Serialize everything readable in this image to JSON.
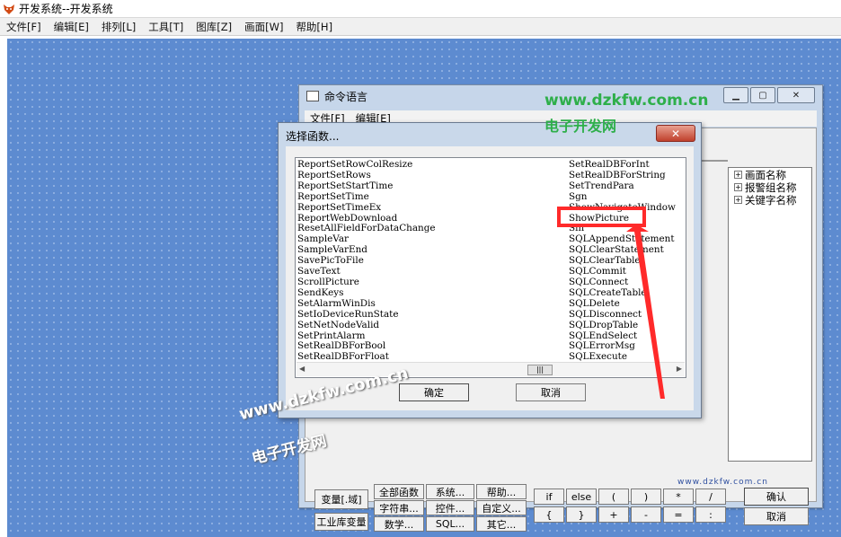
{
  "app": {
    "title": "开发系统--开发系统"
  },
  "menubar": [
    "文件[F]",
    "编辑[E]",
    "排列[L]",
    "工具[T]",
    "图库[Z]",
    "画面[W]",
    "帮助[H]"
  ],
  "command_window": {
    "title": "命令语言",
    "menu": [
      "文件[F]",
      "编辑[E]"
    ],
    "controls": {
      "minimize": "▁",
      "maximize": "▢",
      "close": "✕"
    },
    "tree": [
      {
        "toggle": "+",
        "label": "画面名称"
      },
      {
        "toggle": "+",
        "label": "报警组名称"
      },
      {
        "toggle": "+",
        "label": "关键字名称"
      }
    ],
    "left_buttons": {
      "variable": "变量[.域]",
      "industrial_var": "工业库变量"
    },
    "func_buttons": [
      [
        "全部函数",
        "系统...",
        "帮助..."
      ],
      [
        "字符串...",
        "控件...",
        "自定义..."
      ],
      [
        "数学...",
        "SQL...",
        "其它..."
      ]
    ],
    "keyword_buttons": [
      [
        "if",
        "else",
        "(",
        ")",
        "*",
        "/"
      ],
      [
        "{",
        "}",
        "+",
        "-",
        "=",
        ":"
      ]
    ],
    "confirm": "确认",
    "cancel": "取消"
  },
  "dialog": {
    "title": "选择函数...",
    "close": "✕",
    "list_col1": [
      "ReportSetRowColResize",
      "ReportSetRows",
      "ReportSetStartTime",
      "ReportSetTime",
      "ReportSetTimeEx",
      "ReportWebDownload",
      "ResetAllFieldForDataChange",
      "SampleVar",
      "SampleVarEnd",
      "SavePicToFile",
      "SaveText",
      "ScrollPicture",
      "SendKeys",
      "SetAlarmWinDis",
      "SetIoDeviceRunState",
      "SetNetNodeValid",
      "SetPrintAlarm",
      "SetRealDBForBool",
      "SetRealDBForFloat"
    ],
    "list_col2": [
      "SetRealDBForInt",
      "SetRealDBForString",
      "SetTrendPara",
      "Sgn",
      "ShowNavigateWindow",
      "ShowPicture",
      "Sin",
      "SQLAppendStatement",
      "SQLClearStatement",
      "SQLClearTable",
      "SQLCommit",
      "SQLConnect",
      "SQLCreateTable",
      "SQLDelete",
      "SQLDisconnect",
      "SQLDropTable",
      "SQLEndSelect",
      "SQLErrorMsg",
      "SQLExecute"
    ],
    "scroll_left": "◀",
    "scroll_right": "▶",
    "scroll_thumb": "|||",
    "ok": "确定",
    "cancel": "取消"
  },
  "watermarks": {
    "url": "www.dzkfw.com.cn",
    "name": "电子开发网",
    "small_url": "www.dzkfw.com.cn"
  },
  "colors": {
    "highlight": "#ff2a2a",
    "canvas": "#5d8bd0",
    "watermark_green": "#2eaf4a"
  },
  "icons": {
    "app": "fox-logo-icon",
    "tree_toggle": "plus-box-icon"
  }
}
